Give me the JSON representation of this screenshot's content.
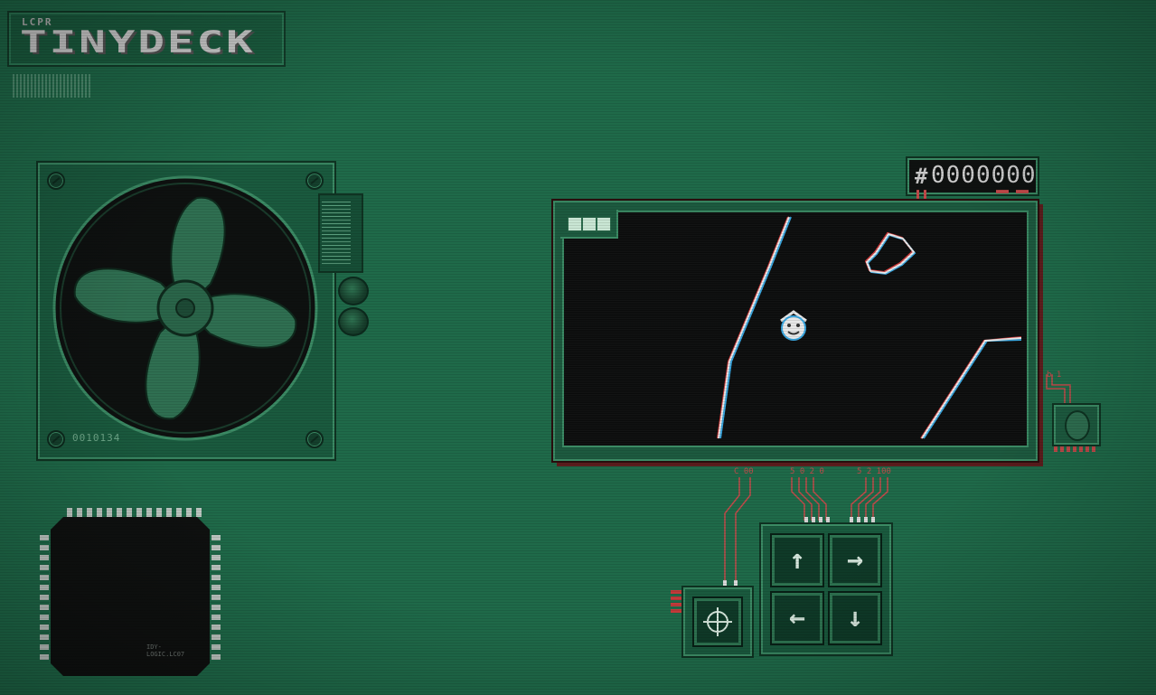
{
  "app": {
    "brand_sub": "LCPR",
    "brand_main": "TINYDECK"
  },
  "fan": {
    "serial": "0010134"
  },
  "chip": {
    "label": "IDY-\nLOGIC.LC07"
  },
  "hud": {
    "score_prefix": "#",
    "score": "0000000",
    "health_cells": 3
  },
  "screen": {
    "player_icon": "smiley-ship-icon"
  },
  "wire_labels": {
    "left_group": "C 00",
    "mid_group": "5 0 2 0",
    "right_group": "5 2 100",
    "side": "b 1"
  },
  "controls": {
    "up": "↑",
    "right": "→",
    "left": "←",
    "down": "↓",
    "action_icon": "crosshair-icon"
  },
  "colors": {
    "background": "#1f6a49",
    "screen": "#0b0c0c",
    "wire": "#c24a4a",
    "accent": "#3b8a64"
  }
}
